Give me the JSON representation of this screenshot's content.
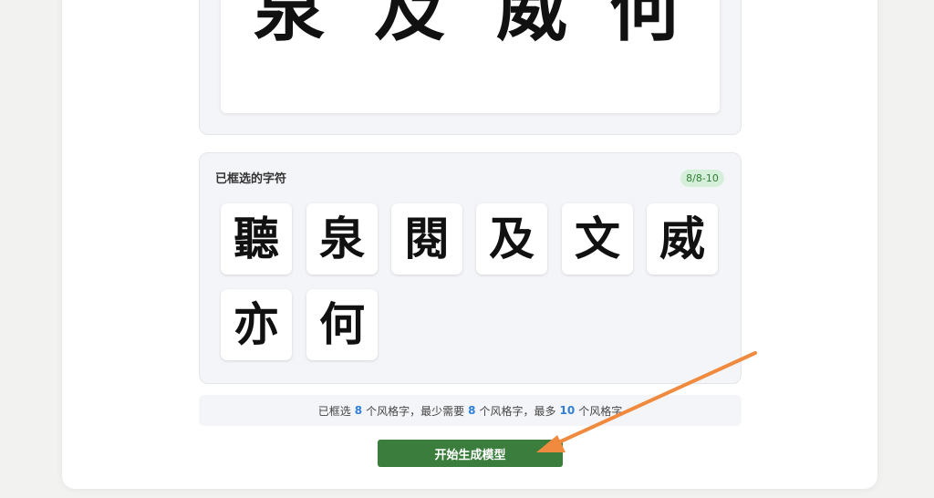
{
  "preview": {
    "glyphs": [
      "泉",
      "及",
      "威",
      "何"
    ]
  },
  "selected_panel": {
    "title": "已框选的字符",
    "badge": "8/8-10",
    "characters": [
      "聽",
      "泉",
      "閱",
      "及",
      "文",
      "威",
      "亦",
      "何"
    ]
  },
  "info_bar": {
    "prefix": "已框选",
    "selected_count": "8",
    "text_1": "个风格字，最少需要",
    "min_count": "8",
    "text_2": "个风格字，最多",
    "max_count": "10",
    "text_3": "个风格字"
  },
  "actions": {
    "generate_label": "开始生成模型"
  },
  "colors": {
    "accent_green": "#3a7d3c",
    "badge_bg": "#d6efdb",
    "number_blue": "#2f7fd6",
    "arrow_orange": "#f08a3e"
  }
}
